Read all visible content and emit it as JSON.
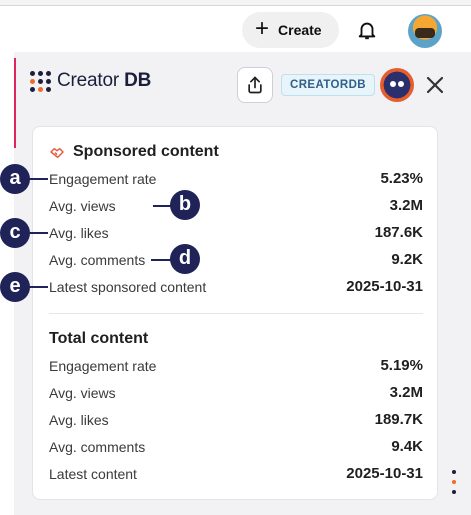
{
  "topbar": {
    "create_label": "Create",
    "create_icon": "plus-icon",
    "notifications_icon": "bell-icon"
  },
  "extension": {
    "brand_light": "Creator",
    "brand_bold": "DB",
    "badge": "CREATORDB",
    "share_icon": "share-icon",
    "close_icon": "close-icon"
  },
  "sponsored": {
    "title": "Sponsored content",
    "icon": "handshake-icon",
    "rows": [
      {
        "label": "Engagement rate",
        "value": "5.23%"
      },
      {
        "label": "Avg. views",
        "value": "3.2M"
      },
      {
        "label": "Avg. likes",
        "value": "187.6K"
      },
      {
        "label": "Avg. comments",
        "value": "9.2K"
      },
      {
        "label": "Latest sponsored content",
        "value": "2025-10-31"
      }
    ]
  },
  "total": {
    "title": "Total content",
    "rows": [
      {
        "label": "Engagement rate",
        "value": "5.19%"
      },
      {
        "label": "Avg. views",
        "value": "3.2M"
      },
      {
        "label": "Avg. likes",
        "value": "189.7K"
      },
      {
        "label": "Avg. comments",
        "value": "9.4K"
      },
      {
        "label": "Latest content",
        "value": "2025-10-31"
      }
    ]
  },
  "callouts": [
    "a",
    "b",
    "c",
    "d",
    "e"
  ],
  "colors": {
    "brand_navy": "#1b1f3b",
    "brand_orange": "#f26a2b",
    "callout": "#1f2357",
    "accent_red": "#e0245e"
  }
}
